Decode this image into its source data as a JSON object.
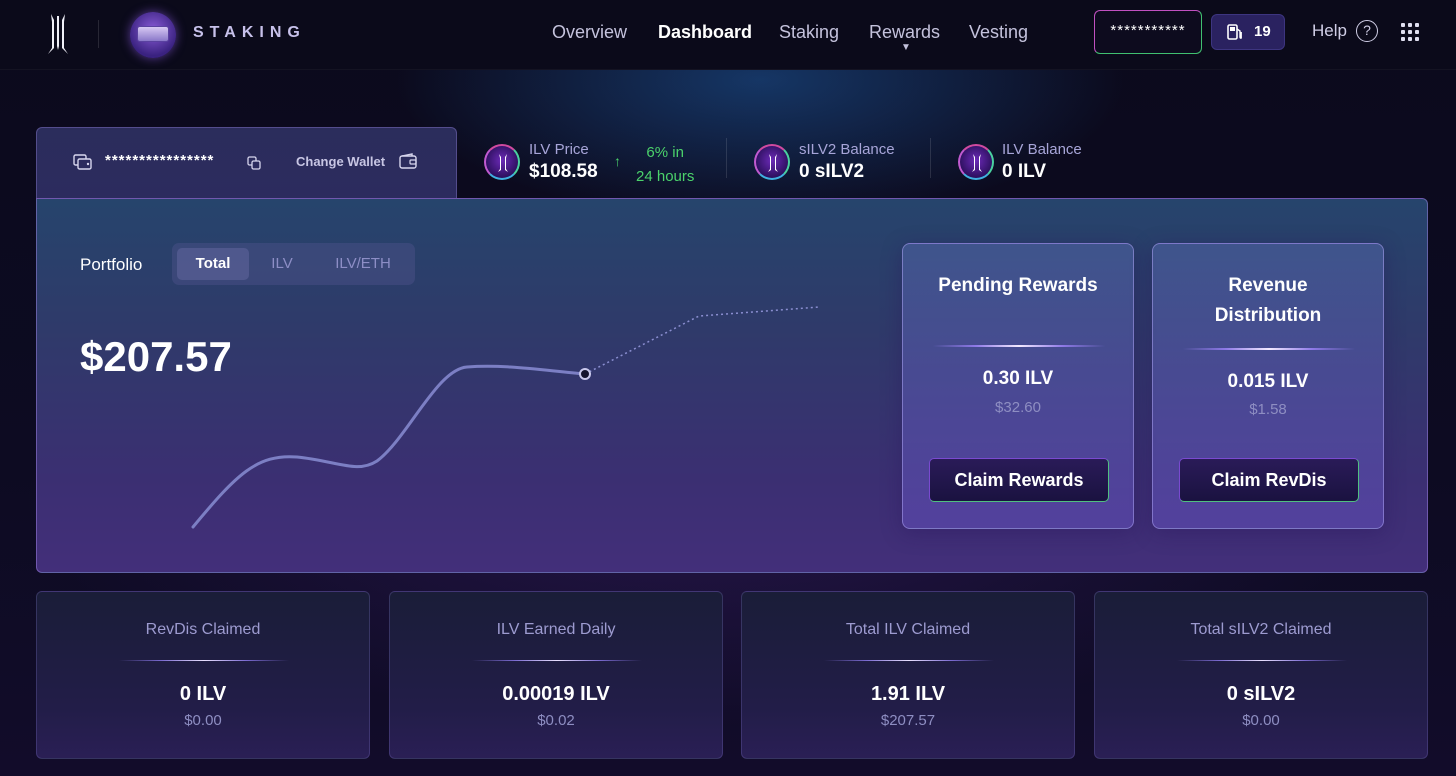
{
  "header": {
    "brand": "STAKING",
    "nav": [
      "Overview",
      "Dashboard",
      "Staking",
      "Rewards",
      "Vesting"
    ],
    "active_nav": "Dashboard",
    "wallet_masked": "***********",
    "gas_count": "19",
    "help_label": "Help",
    "help_glyph": "?"
  },
  "wallet": {
    "address_masked": "****************",
    "change_label": "Change Wallet"
  },
  "stats": {
    "ilv_price_label": "ILV Price",
    "ilv_price_value": "$108.58",
    "change_line1": "6% in",
    "change_line2": "24 hours",
    "silv2_label": "sILV2 Balance",
    "silv2_value": "0 sILV2",
    "ilv_label": "ILV Balance",
    "ilv_value": "0 ILV"
  },
  "portfolio": {
    "label": "Portfolio",
    "tabs": [
      "Total",
      "ILV",
      "ILV/ETH"
    ],
    "active_tab": "Total",
    "value": "$207.57"
  },
  "pending": {
    "title_line1": "Pending Rewards",
    "amount": "0.30 ILV",
    "usd": "$32.60",
    "button": "Claim Rewards"
  },
  "revenue": {
    "title_line1": "Revenue",
    "title_line2": "Distribution",
    "amount": "0.015 ILV",
    "usd": "$1.58",
    "button": "Claim RevDis"
  },
  "cards": [
    {
      "label": "RevDis Claimed",
      "value": "0 ILV",
      "usd": "$0.00"
    },
    {
      "label": "ILV Earned Daily",
      "value": "0.00019 ILV",
      "usd": "$0.02"
    },
    {
      "label": "Total ILV Claimed",
      "value": "1.91 ILV",
      "usd": "$207.57"
    },
    {
      "label": "Total sILV2 Claimed",
      "value": "0 sILV2",
      "usd": "$0.00"
    }
  ],
  "colors": {
    "accent": "#a7a5d8",
    "positive": "#4bd26b",
    "chart_line": "#7c7fc4"
  },
  "icons": [
    "illuvium-logo-icon",
    "staking-badge-icon",
    "gas-pump-icon",
    "help-icon",
    "apps-grid-icon",
    "wallet-icon",
    "copy-icon",
    "arrow-up-icon",
    "ilv-coin-icon",
    "silv2-coin-icon"
  ]
}
